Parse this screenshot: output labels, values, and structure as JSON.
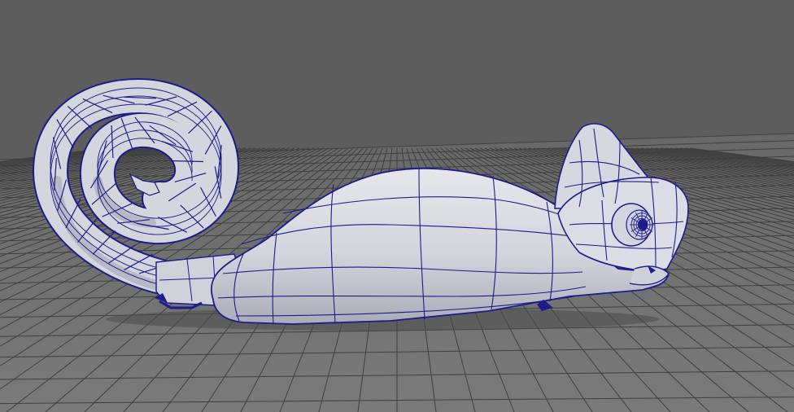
{
  "viewport": {
    "background_color": "#5d5d5d",
    "grid_color": "#3c3c3c",
    "ground_color": "#707070",
    "mesh_fill_color": "#d8d9e0",
    "mesh_shadow_color": "#9fa2ae",
    "wireframe_color": "#1c1c8a",
    "object": "chameleon-polygon-mesh"
  }
}
